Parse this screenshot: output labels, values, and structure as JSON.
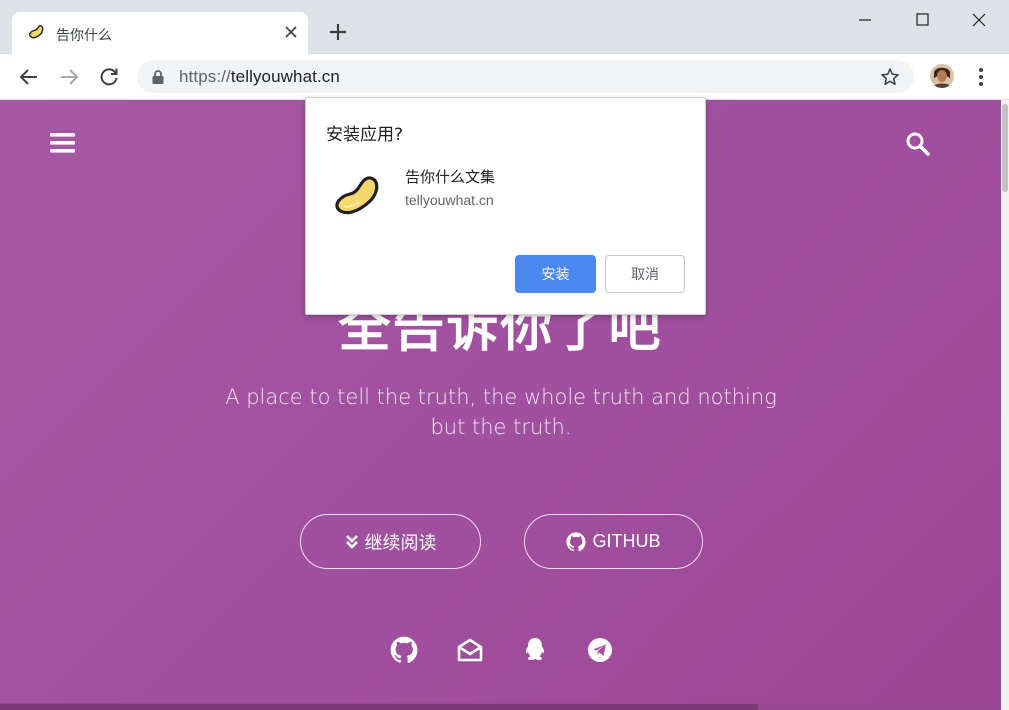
{
  "browser": {
    "tab": {
      "title": "告你什么"
    },
    "url": {
      "scheme": "https://",
      "host": "tellyouwhat.cn"
    },
    "icons": [
      "app-favicon",
      "close-icon",
      "plus-icon",
      "minimize-icon",
      "maximize-icon",
      "close-window-icon",
      "back-arrow-icon",
      "forward-arrow-icon",
      "reload-icon",
      "lock-icon",
      "star-icon",
      "avatar",
      "kebab-menu-icon"
    ]
  },
  "page": {
    "hero_title": "全告诉你了吧",
    "tagline": "A place to tell the truth, the whole truth and nothing but the truth.",
    "buttons": {
      "read_more": "继续阅读",
      "github": "GITHUB"
    },
    "social_icons": [
      "github-icon",
      "mail-icon",
      "qq-icon",
      "telegram-icon"
    ],
    "background_color": "#a352a0"
  },
  "dialog": {
    "title": "安装应用?",
    "app_name": "告你什么文集",
    "origin": "tellyouwhat.cn",
    "install_label": "安装",
    "cancel_label": "取消",
    "accent": "#4a87ee"
  }
}
